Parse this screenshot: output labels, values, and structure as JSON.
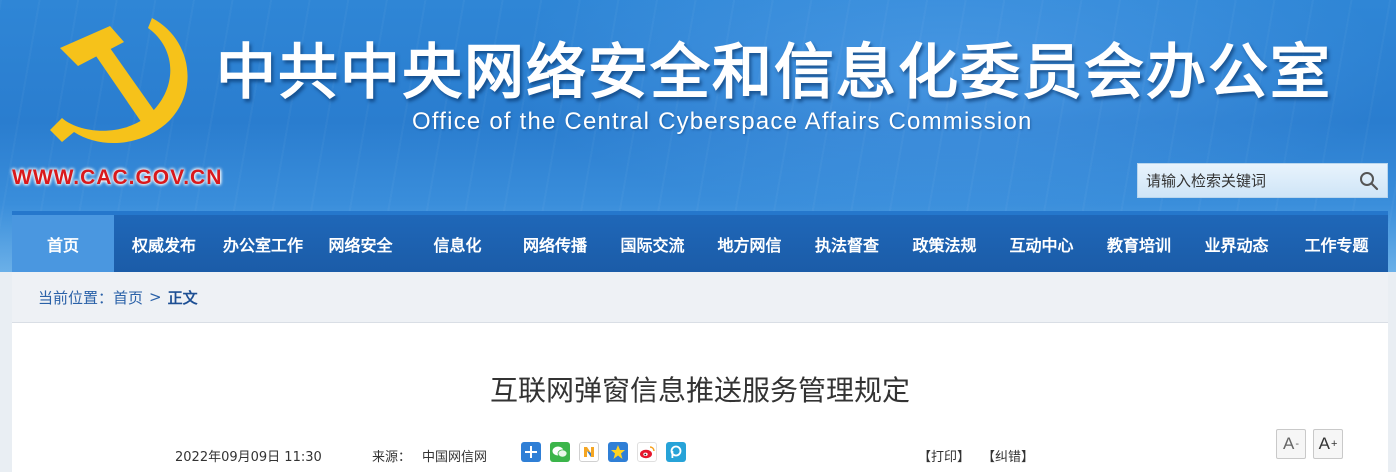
{
  "header": {
    "title": "中共中央网络安全和信息化委员会办公室",
    "subtitle": "Office of the Central Cyberspace Affairs Commission",
    "url": "WWW.CAC.GOV.CN",
    "emblem_icon": "party-emblem-icon",
    "colors": {
      "banner": "#2a7dcf",
      "url": "#d9191c",
      "emblem": "#f6c21a"
    }
  },
  "search": {
    "placeholder": "请输入检索关键词",
    "value": "",
    "icon": "search-icon"
  },
  "nav": {
    "items": [
      {
        "label": "首页",
        "active": true
      },
      {
        "label": "权威发布"
      },
      {
        "label": "办公室工作"
      },
      {
        "label": "网络安全"
      },
      {
        "label": "信息化"
      },
      {
        "label": "网络传播"
      },
      {
        "label": "国际交流"
      },
      {
        "label": "地方网信"
      },
      {
        "label": "执法督查"
      },
      {
        "label": "政策法规"
      },
      {
        "label": "互动中心"
      },
      {
        "label": "教育培训"
      },
      {
        "label": "业界动态"
      },
      {
        "label": "工作专题"
      }
    ],
    "colors": {
      "bar": "#1f67b8",
      "active": "#4a97e0"
    }
  },
  "breadcrumb": {
    "prefix": "当前位置：",
    "home": "首页",
    "separator": ">",
    "current": "正文"
  },
  "article": {
    "title": "互联网弹窗信息推送服务管理规定",
    "date": "2022年09月09日 11:30",
    "source_label": "来源：",
    "source": "中国网信网",
    "share_icons": [
      "share-more-icon",
      "wechat-icon",
      "qzone-icon",
      "qq-space-icon",
      "weibo-icon",
      "pengyou-icon"
    ],
    "print": "【打印】",
    "correct": "【纠错】",
    "font_smaller": "A",
    "font_larger": "A",
    "font_smaller_sign": "-",
    "font_larger_sign": "+"
  }
}
